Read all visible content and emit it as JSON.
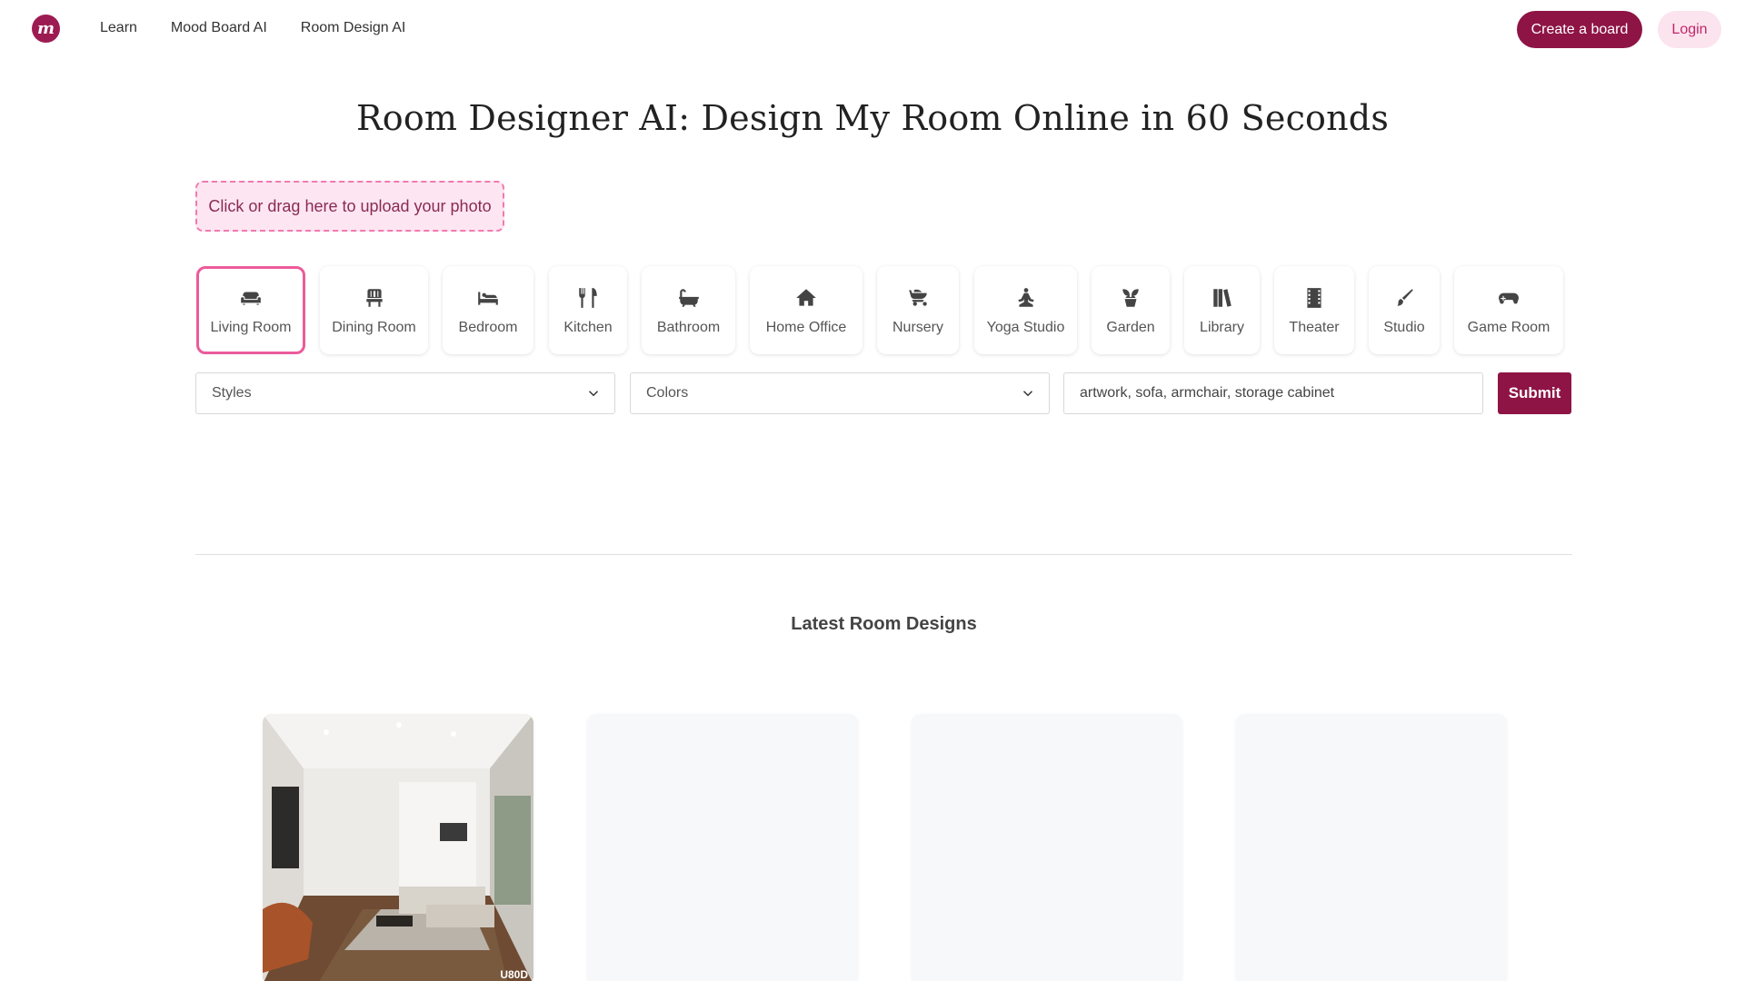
{
  "header": {
    "logo_text": "m",
    "nav": [
      "Learn",
      "Mood Board AI",
      "Room Design AI"
    ],
    "create_label": "Create a board",
    "login_label": "Login"
  },
  "title": "Room Designer AI: Design My Room Online in 60 Seconds",
  "upload_label": "Click or drag here to upload your photo",
  "rooms": [
    {
      "label": "Living Room",
      "icon": "sofa-icon",
      "active": true
    },
    {
      "label": "Dining Room",
      "icon": "chair-icon"
    },
    {
      "label": "Bedroom",
      "icon": "bed-icon"
    },
    {
      "label": "Kitchen",
      "icon": "utensils-icon"
    },
    {
      "label": "Bathroom",
      "icon": "bathtub-icon"
    },
    {
      "label": "Home Office",
      "icon": "house-icon"
    },
    {
      "label": "Nursery",
      "icon": "stroller-icon"
    },
    {
      "label": "Yoga Studio",
      "icon": "yoga-icon"
    },
    {
      "label": "Garden",
      "icon": "plant-icon"
    },
    {
      "label": "Library",
      "icon": "books-icon"
    },
    {
      "label": "Theater",
      "icon": "film-icon"
    },
    {
      "label": "Studio",
      "icon": "brush-icon"
    },
    {
      "label": "Game Room",
      "icon": "gamepad-icon"
    }
  ],
  "controls": {
    "styles_label": "Styles",
    "colors_label": "Colors",
    "items_value": "artwork, sofa, armchair, storage cabinet",
    "submit_label": "Submit"
  },
  "latest_heading": "Latest Room Designs",
  "cards": [
    {
      "badge": "U80D",
      "loaded": true
    },
    {
      "loaded": false
    },
    {
      "loaded": false
    },
    {
      "loaded": false
    }
  ],
  "colors": {
    "brand": "#8e1446",
    "accent_pink": "#ec5b9b",
    "upload_bg": "#fde6f1"
  }
}
